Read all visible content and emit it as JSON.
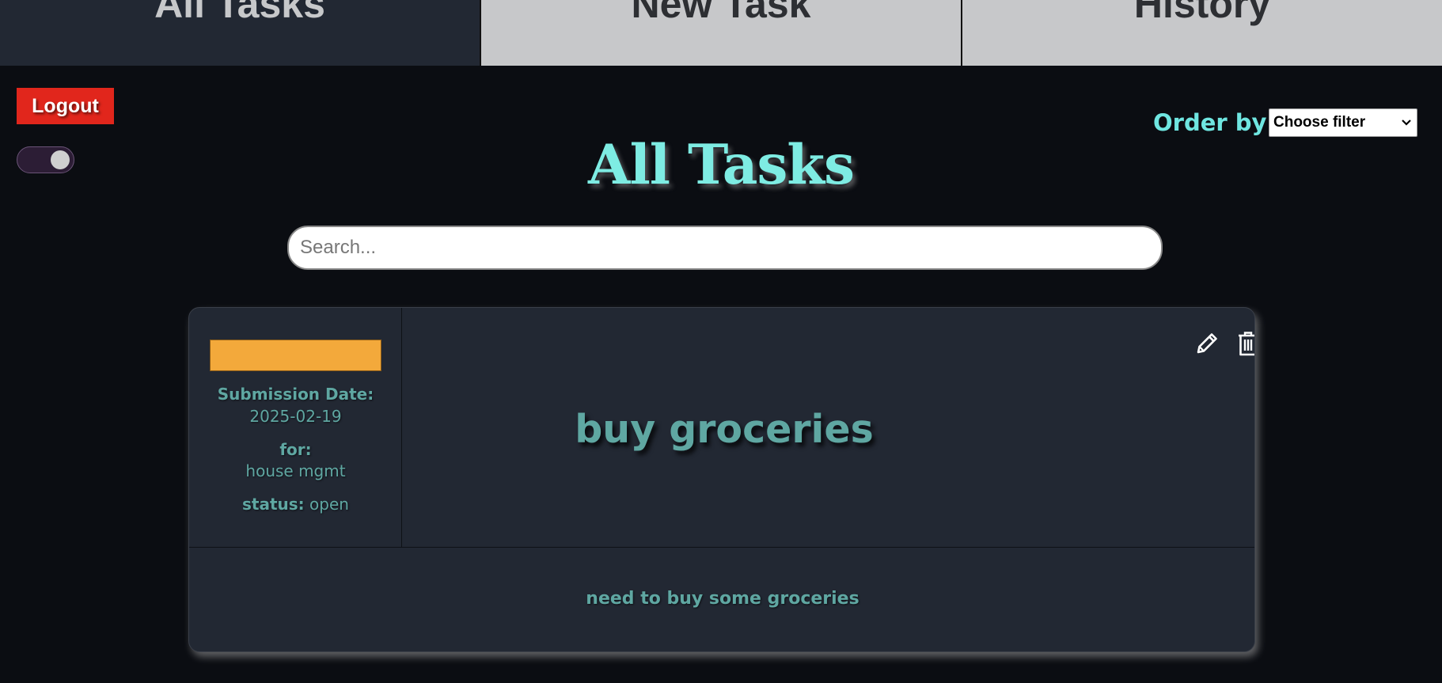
{
  "nav": {
    "tabs": [
      {
        "label": "All Tasks",
        "active": true
      },
      {
        "label": "New Task",
        "active": false
      },
      {
        "label": "History",
        "active": false
      }
    ]
  },
  "controls": {
    "logout_label": "Logout",
    "theme_toggle_on": true
  },
  "order": {
    "label": "Order by:",
    "selected": "Choose filter"
  },
  "page": {
    "title": "All Tasks"
  },
  "search": {
    "placeholder": "Search...",
    "value": ""
  },
  "tasks": [
    {
      "title": "buy groceries",
      "submission_label": "Submission Date:",
      "submission_date": "2025-02-19",
      "for_label": "for:",
      "for_value": "house mgmt",
      "status_label": "status:",
      "status_value": "open",
      "description": "need to buy some groceries",
      "priority_color": "#f3a93b",
      "done_toggle_on": true
    }
  ],
  "colors": {
    "accent": "#7eece3",
    "logout": "#e1261c",
    "card_text": "#5fa7a2",
    "toggle_on": "#5fe046"
  },
  "icons": [
    "pencil-icon",
    "trash-icon",
    "chevron-down-icon"
  ]
}
